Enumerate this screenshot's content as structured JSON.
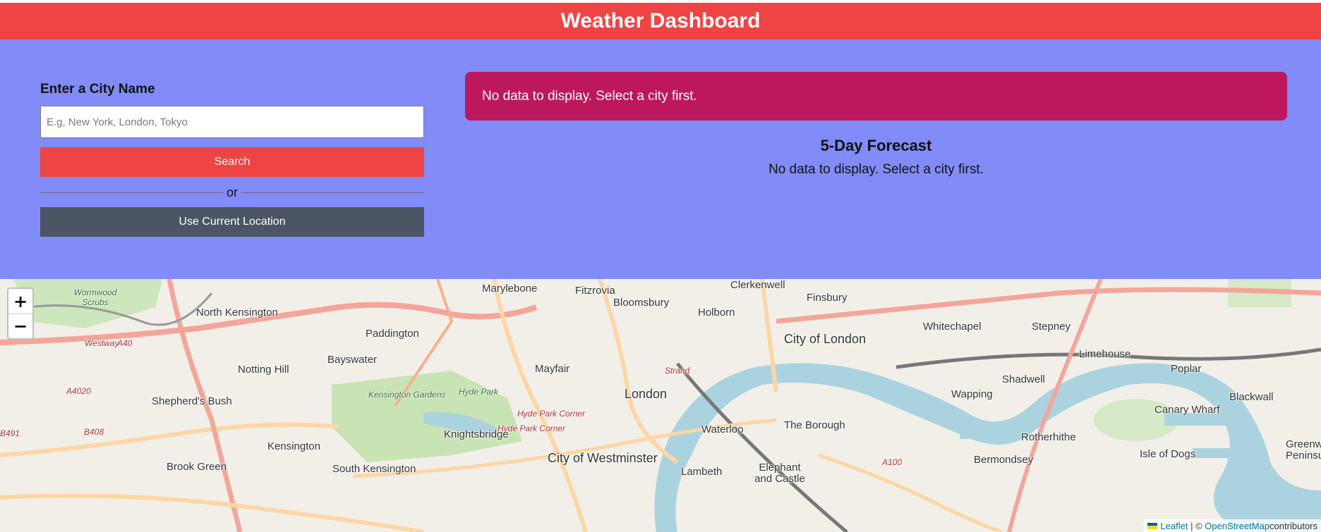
{
  "header": {
    "title": "Weather Dashboard"
  },
  "search": {
    "label": "Enter a City Name",
    "placeholder": "E.g, New York, London, Tokyo",
    "search_button": "Search",
    "divider": "or",
    "location_button": "Use Current Location"
  },
  "current": {
    "message": "No data to display. Select a city first."
  },
  "forecast": {
    "title": "5-Day Forecast",
    "message": "No data to display. Select a city first."
  },
  "map": {
    "zoom_in": "+",
    "zoom_out": "−",
    "labels": {
      "marylebone": "Marylebone",
      "fitzrovia": "Fitzrovia",
      "clerkenwell": "Clerkenwell",
      "finsbury": "Finsbury",
      "bloomsbury": "Bloomsbury",
      "holborn": "Holborn",
      "north_kensington": "North Kensington",
      "paddington": "Paddington",
      "city_of_london": "City of London",
      "whitechapel": "Whitechapel",
      "stepney": "Stepney",
      "limehouse": "Limehouse",
      "bayswater": "Bayswater",
      "notting_hill": "Notting Hill",
      "mayfair": "Mayfair",
      "shadwell": "Shadwell",
      "poplar": "Poplar",
      "london": "London",
      "wapping": "Wapping",
      "blackwall": "Blackwall",
      "canary_wharf": "Canary Wharf",
      "shepherds_bush": "Shepherd's Bush",
      "kensington_gardens": "Kensington Gardens",
      "hyde_park": "Hyde Park",
      "hyde_park_corner": "Hyde Park Corner",
      "knightsbridge": "Knightsbridge",
      "waterloo": "Waterloo",
      "the_borough": "The Borough",
      "rotherhithe": "Rotherhithe",
      "kensington": "Kensington",
      "bermondsey": "Bermondsey",
      "isle_of_dogs": "Isle of Dogs",
      "city_of_westminster": "City of Westminster",
      "brook_green": "Brook Green",
      "south_kensington": "South Kensington",
      "lambeth": "Lambeth",
      "elephant_and_castle": "Elephant and Castle",
      "greenwich_peninsula": "Greenwich Peninsula",
      "wormwood_scrubs": "Wormwood Scrubs",
      "westway": "Westway",
      "a40": "A40",
      "a4020": "A4020",
      "b491": "B491",
      "b408": "B408",
      "a100": "A100",
      "strand": "Strand"
    },
    "attribution": {
      "leaflet": "Leaflet",
      "separator": " | © ",
      "osm": "OpenStreetMap",
      "suffix": "contributors"
    }
  },
  "colors": {
    "header_bg": "#ef4444",
    "panel_bg": "#818cf8",
    "current_box_bg": "#be185d",
    "search_button_bg": "#ef4444",
    "location_button_bg": "#4b5563"
  }
}
